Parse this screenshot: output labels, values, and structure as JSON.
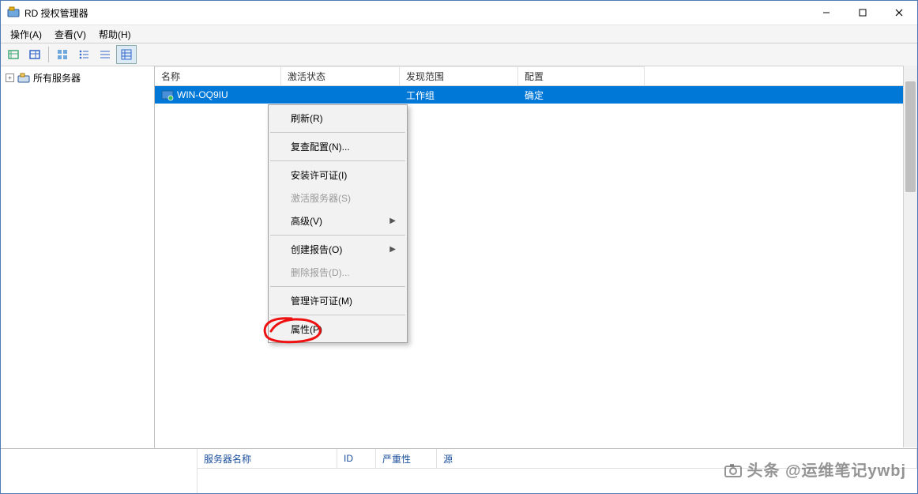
{
  "titlebar": {
    "title": "RD 授权管理器"
  },
  "menubar": {
    "action": "操作(A)",
    "view": "查看(V)",
    "help": "帮助(H)"
  },
  "tree": {
    "root_label": "所有服务器"
  },
  "columns": {
    "name": "名称",
    "activation": "激活状态",
    "scope": "发现范围",
    "config": "配置"
  },
  "row": {
    "name": "WIN-OQ9IU",
    "activation_visible": "",
    "scope": "工作组",
    "config": "确定"
  },
  "ctx": {
    "refresh": "刷新(R)",
    "recheck": "复查配置(N)...",
    "install_lic": "安装许可证(I)",
    "activate_srv": "激活服务器(S)",
    "advanced": "高级(V)",
    "create_report": "创建报告(O)",
    "delete_report": "删除报告(D)...",
    "manage_lic": "管理许可证(M)",
    "properties": "属性(P)"
  },
  "bottom_columns": {
    "server": "服务器名称",
    "id": "ID",
    "severity": "严重性",
    "source": "源"
  },
  "watermark": "头条 @运维笔记ywbj"
}
